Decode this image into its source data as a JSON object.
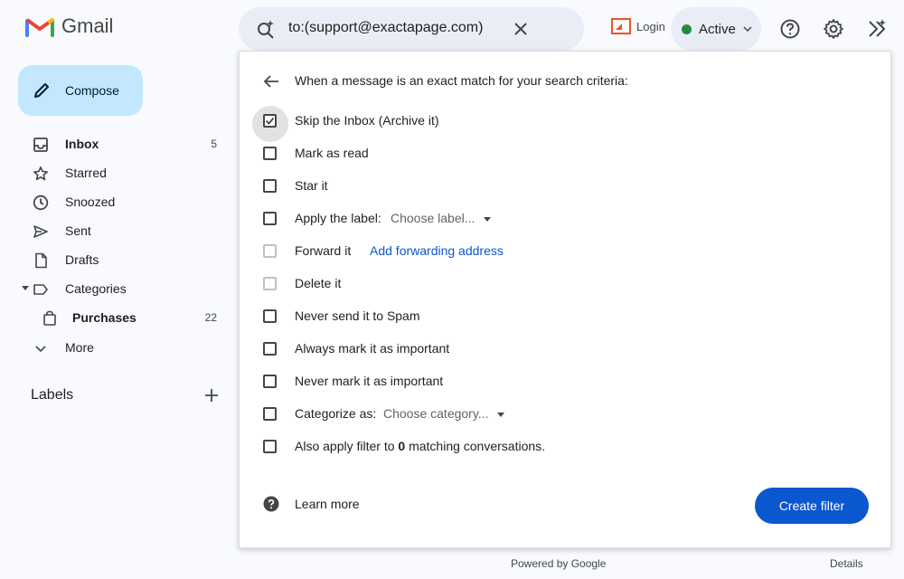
{
  "app": {
    "logo_text": "Gmail",
    "brand_colors": {
      "red": "#ea4335",
      "blue": "#4285f4",
      "green": "#34a853",
      "yellow": "#fbbc04"
    }
  },
  "header": {
    "search_query": "to:(support@exactapage.com)",
    "search_icon": "search-sparkle-icon",
    "clear_icon": "close-icon",
    "login_label": "Login",
    "status_label": "Active",
    "status_color": "#1e8e3e",
    "icons": [
      "help-icon",
      "gear-icon",
      "gemini-icon"
    ]
  },
  "sidebar": {
    "compose_label": "Compose",
    "items": [
      {
        "label": "Inbox",
        "count": "5",
        "icon": "inbox-icon",
        "bold": true
      },
      {
        "label": "Starred",
        "count": "",
        "icon": "star-icon"
      },
      {
        "label": "Snoozed",
        "count": "",
        "icon": "clock-icon"
      },
      {
        "label": "Sent",
        "count": "",
        "icon": "send-icon"
      },
      {
        "label": "Drafts",
        "count": "",
        "icon": "draft-icon"
      },
      {
        "label": "Categories",
        "count": "",
        "icon": "label-icon"
      },
      {
        "label": "Purchases",
        "count": "22",
        "icon": "shopping-bag-icon",
        "bold": true
      },
      {
        "label": "More",
        "count": "",
        "icon": "chevron-down-icon"
      }
    ],
    "labels_heading": "Labels"
  },
  "filter": {
    "heading": "When a message is an exact match for your search criteria:",
    "options": [
      {
        "label": "Skip the Inbox (Archive it)",
        "checked": true
      },
      {
        "label": "Mark as read",
        "checked": false
      },
      {
        "label": "Star it",
        "checked": false
      },
      {
        "label": "Apply the label:",
        "checked": false,
        "dropdown": "Choose label..."
      },
      {
        "label": "Forward it",
        "checked": false,
        "link": "Add forwarding address",
        "disabled": true
      },
      {
        "label": "Delete it",
        "checked": false,
        "disabled": true
      },
      {
        "label": "Never send it to Spam",
        "checked": false
      },
      {
        "label": "Always mark it as important",
        "checked": false
      },
      {
        "label": "Never mark it as important",
        "checked": false
      },
      {
        "label": "Categorize as:",
        "checked": false,
        "dropdown": "Choose category..."
      },
      {
        "label_prefix": "Also apply filter to",
        "label_count": "0",
        "label_suffix": "matching conversations.",
        "checked": false
      }
    ],
    "learn_more": "Learn more",
    "create_button": "Create filter",
    "accent_color": "#0b57d0"
  },
  "footer": {
    "powered_by": "Powered by Google",
    "details": "Details"
  }
}
